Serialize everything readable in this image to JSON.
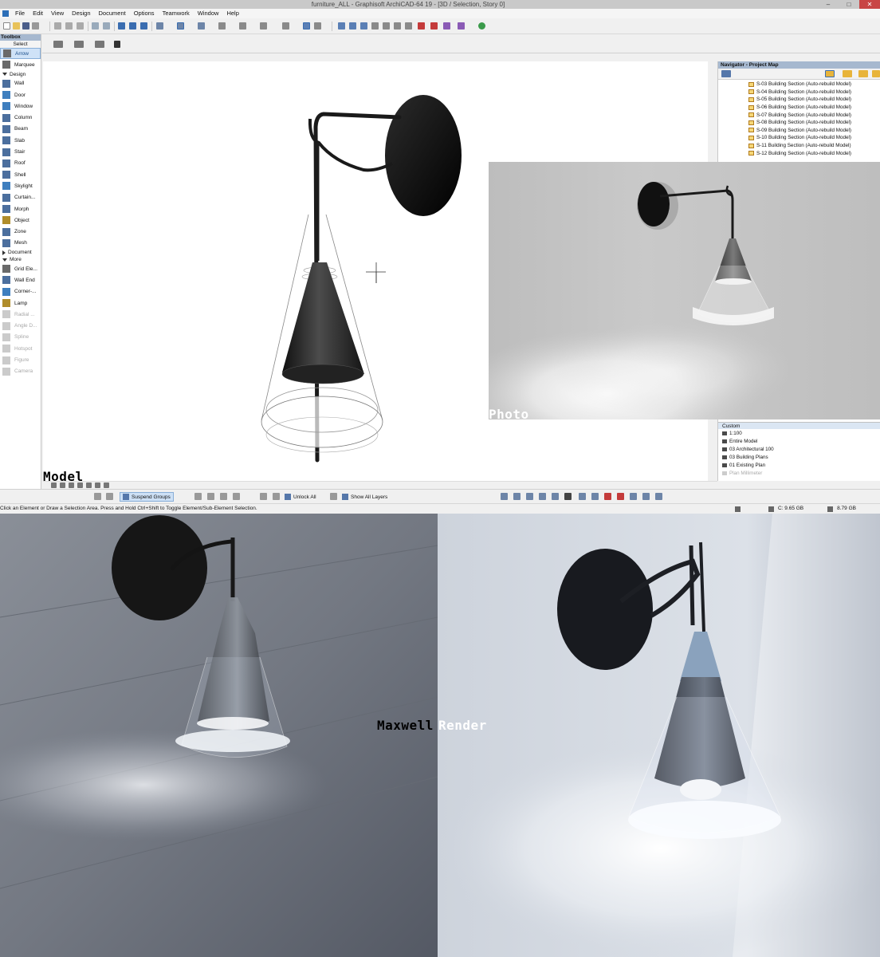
{
  "window": {
    "title": "furniture_ALL - Graphisoft ArchiCAD-64 19 - [3D / Selection, Story 0]",
    "minimize": "–",
    "maximize": "□",
    "close": "✕"
  },
  "menu": [
    "File",
    "Edit",
    "View",
    "Design",
    "Document",
    "Options",
    "Teamwork",
    "Window",
    "Help"
  ],
  "toolbox": {
    "title": "Toolbox",
    "select_header": "Select",
    "select_tools": [
      {
        "label": "Arrow",
        "icon": "arrow-icon",
        "active": true
      },
      {
        "label": "Marquee",
        "icon": "marquee-icon"
      }
    ],
    "design_header": "Design",
    "design_tools": [
      {
        "label": "Wall",
        "icon": "wall-icon"
      },
      {
        "label": "Door",
        "icon": "door-icon"
      },
      {
        "label": "Window",
        "icon": "window-tool-icon"
      },
      {
        "label": "Column",
        "icon": "column-icon"
      },
      {
        "label": "Beam",
        "icon": "beam-icon"
      },
      {
        "label": "Slab",
        "icon": "slab-icon"
      },
      {
        "label": "Stair",
        "icon": "stair-icon"
      },
      {
        "label": "Roof",
        "icon": "roof-icon"
      },
      {
        "label": "Shell",
        "icon": "shell-icon"
      },
      {
        "label": "Skylight",
        "icon": "skylight-icon"
      },
      {
        "label": "Curtain...",
        "icon": "curtain-wall-icon"
      },
      {
        "label": "Morph",
        "icon": "morph-icon"
      },
      {
        "label": "Object",
        "icon": "object-icon"
      },
      {
        "label": "Zone",
        "icon": "zone-icon"
      },
      {
        "label": "Mesh",
        "icon": "mesh-icon"
      }
    ],
    "document_header": "Document",
    "more_header": "More",
    "more_tools": [
      {
        "label": "Grid Ele...",
        "icon": "grid-element-icon"
      },
      {
        "label": "Wall End",
        "icon": "wall-end-icon"
      },
      {
        "label": "Corner-...",
        "icon": "corner-window-icon"
      },
      {
        "label": "Lamp",
        "icon": "lamp-icon"
      },
      {
        "label": "Radial ...",
        "icon": "radial-dimension-icon",
        "disabled": true
      },
      {
        "label": "Angle D...",
        "icon": "angle-dimension-icon",
        "disabled": true
      },
      {
        "label": "Spline",
        "icon": "spline-icon",
        "disabled": true
      },
      {
        "label": "Hotspot",
        "icon": "hotspot-icon",
        "disabled": true
      },
      {
        "label": "Figure",
        "icon": "figure-icon",
        "disabled": true
      },
      {
        "label": "Camera",
        "icon": "camera-icon",
        "disabled": true
      }
    ]
  },
  "navigator": {
    "title": "Navigator - Project Map",
    "sections": [
      "S-03 Building Section (Auto-rebuild Model)",
      "S-04 Building Section (Auto-rebuild Model)",
      "S-05 Building Section (Auto-rebuild Model)",
      "S-06 Building Section (Auto-rebuild Model)",
      "S-07 Building Section (Auto-rebuild Model)",
      "S-08 Building Section (Auto-rebuild Model)",
      "S-09 Building Section (Auto-rebuild Model)",
      "S-10 Building Section (Auto-rebuild Model)",
      "S-11 Building Section (Auto-rebuild Model)",
      "S-12 Building Section (Auto-rebuild Model)"
    ],
    "custom_label": "Custom",
    "view_settings": [
      {
        "label": "1:100"
      },
      {
        "label": "Entire Model"
      },
      {
        "label": "03 Architectural 100"
      },
      {
        "label": "03 Building Plans"
      },
      {
        "label": "01 Existing Plan"
      },
      {
        "label": "Plan Millimeter",
        "dim": true
      }
    ]
  },
  "bottom_toolbar": {
    "suspend_groups": "Suspend Groups",
    "unlock_all": "Unlock All",
    "show_all_layers": "Show All Layers"
  },
  "status": {
    "message": "Click an Element or Draw a Selection Area. Press and Hold Ctrl+Shift to Toggle Element/Sub-Element Selection.",
    "disk_c": "C: 9.65 GB",
    "memory": "8.79 GB"
  },
  "labels": {
    "model": "Model",
    "photo": "Photo",
    "maxwell": "Maxwell",
    "render": "Render"
  },
  "colors": {
    "accent": "#2d6fb8",
    "panel_title": "#a6b8cf",
    "active_tool": "#cfe2f7"
  }
}
